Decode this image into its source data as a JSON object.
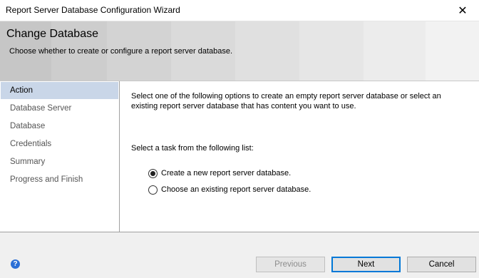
{
  "window": {
    "title": "Report Server Database Configuration Wizard",
    "close_glyph": "✕"
  },
  "banner": {
    "heading": "Change Database",
    "subheading": "Choose whether to create or configure a report server database."
  },
  "sidebar": {
    "items": [
      {
        "label": "Action",
        "active": true
      },
      {
        "label": "Database Server",
        "active": false
      },
      {
        "label": "Database",
        "active": false
      },
      {
        "label": "Credentials",
        "active": false
      },
      {
        "label": "Summary",
        "active": false
      },
      {
        "label": "Progress and Finish",
        "active": false
      }
    ]
  },
  "main": {
    "intro": "Select one of the following options to create an empty report server database or select an existing report server database that has content you want to use.",
    "task_label": "Select a task from the following list:",
    "options": [
      {
        "label": "Create a new report server database.",
        "selected": true
      },
      {
        "label": "Choose an existing report server database.",
        "selected": false
      }
    ]
  },
  "footer": {
    "help_glyph": "?",
    "help_icon": "help-icon",
    "previous_label": "Previous",
    "next_label": "Next",
    "cancel_label": "Cancel"
  }
}
